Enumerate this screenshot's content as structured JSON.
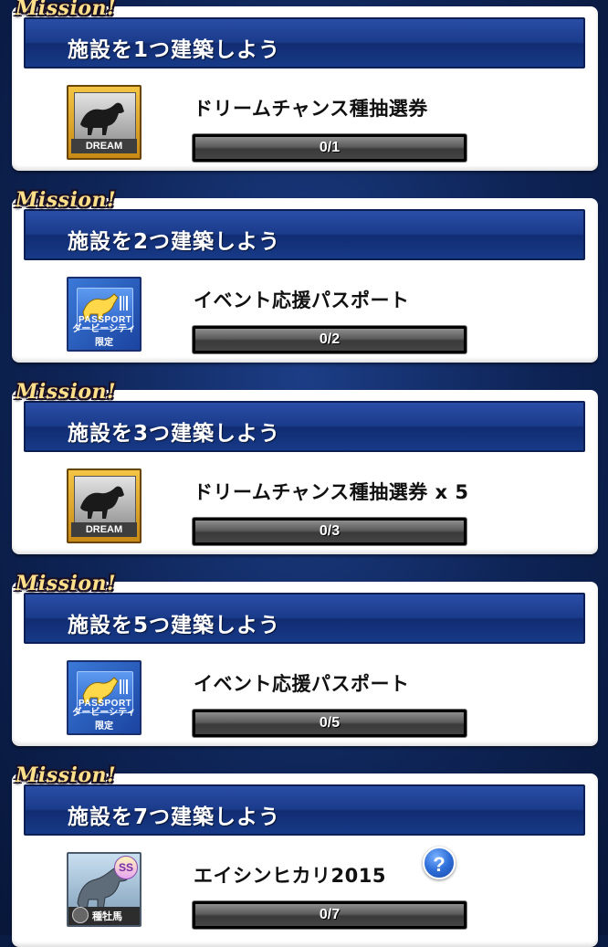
{
  "ribbon_label": "Mission!",
  "missions": [
    {
      "title": "施設を1つ建築しよう",
      "reward_name": "ドリームチャンス種抽選券",
      "progress_text": "0/1",
      "progress": 0,
      "icon": "dream-ticket-icon",
      "icon_label": "DREAM"
    },
    {
      "title": "施設を2つ建築しよう",
      "reward_name": "イベント応援パスポート",
      "progress_text": "0/2",
      "progress": 0,
      "icon": "event-passport-icon",
      "icon_label": "PASSPORT",
      "icon_sublabel": "ダービーシティ限定"
    },
    {
      "title": "施設を3つ建築しよう",
      "reward_name": "ドリームチャンス種抽選券 x 5",
      "progress_text": "0/3",
      "progress": 0,
      "icon": "dream-ticket-icon",
      "icon_label": "DREAM"
    },
    {
      "title": "施設を5つ建築しよう",
      "reward_name": "イベント応援パスポート",
      "progress_text": "0/5",
      "progress": 0,
      "icon": "event-passport-icon",
      "icon_label": "PASSPORT",
      "icon_sublabel": "ダービーシティ限定"
    },
    {
      "title": "施設を7つ建築しよう",
      "reward_name": "エイシンヒカリ2015",
      "progress_text": "0/7",
      "progress": 0,
      "icon": "stallion-card-icon",
      "icon_label": "種牡馬",
      "rank_badge": "SS",
      "help_label": "?"
    }
  ],
  "colors": {
    "header_blue": "#1b3b8b",
    "background": "#0e2456",
    "dream_gold": "#e2a313",
    "help_blue": "#2e6ed8"
  }
}
